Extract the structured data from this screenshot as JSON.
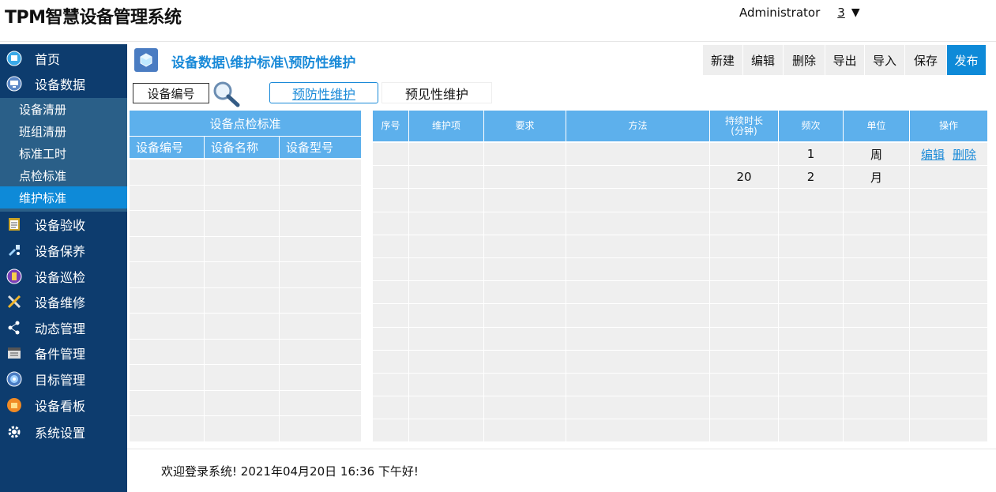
{
  "header": {
    "title": "TPM智慧设备管理系统",
    "user": "Administrator",
    "count": "3",
    "caret": "▼"
  },
  "sidebar": {
    "items": [
      {
        "label": "首页",
        "icon": "home-icon"
      },
      {
        "label": "设备数据",
        "icon": "monitor-icon"
      },
      {
        "label": "设备验收",
        "icon": "clipboard-icon"
      },
      {
        "label": "设备保养",
        "icon": "maintenance-icon"
      },
      {
        "label": "设备巡检",
        "icon": "inspection-icon"
      },
      {
        "label": "设备维修",
        "icon": "tools-icon"
      },
      {
        "label": "动态管理",
        "icon": "share-icon"
      },
      {
        "label": "备件管理",
        "icon": "parts-icon"
      },
      {
        "label": "目标管理",
        "icon": "target-icon"
      },
      {
        "label": "设备看板",
        "icon": "dashboard-icon"
      },
      {
        "label": "系统设置",
        "icon": "gear-icon"
      }
    ],
    "sub_items": [
      {
        "label": "设备清册"
      },
      {
        "label": "班组清册"
      },
      {
        "label": "标准工时"
      },
      {
        "label": "点检标准"
      },
      {
        "label": "维护标准"
      }
    ],
    "active_sub": "维护标准"
  },
  "breadcrumb": "设备数据\\维护标准\\预防性维护",
  "toolbar": {
    "buttons": [
      "新建",
      "编辑",
      "删除",
      "导出",
      "导入",
      "保存",
      "发布"
    ]
  },
  "filter": {
    "label": "设备编号"
  },
  "tabs": {
    "active": "预防性维护",
    "inactive": "预见性维护"
  },
  "left_panel": {
    "title": "设备点检标准",
    "columns": [
      "设备编号",
      "设备名称",
      "设备型号"
    ]
  },
  "table": {
    "columns": [
      "序号",
      "维护项",
      "要求",
      "方法",
      "持续时长\n(分钟)",
      "频次",
      "单位",
      "操作"
    ],
    "rows": [
      [
        "",
        "",
        "",
        "",
        "",
        "1",
        "周",
        ""
      ],
      [
        "",
        "",
        "",
        "",
        "20",
        "2",
        "月",
        ""
      ]
    ],
    "ops": [
      "编辑",
      "删除"
    ]
  },
  "footer": {
    "message": "欢迎登录系统!   2021年04月20日 16:36 下午好!"
  },
  "colors": {
    "sidebar_bg": "#0d3c6e",
    "submenu_bg": "#2a5f88",
    "accent": "#0e8ad8",
    "table_header": "#5db0ec",
    "cell_bg": "#efefef"
  }
}
